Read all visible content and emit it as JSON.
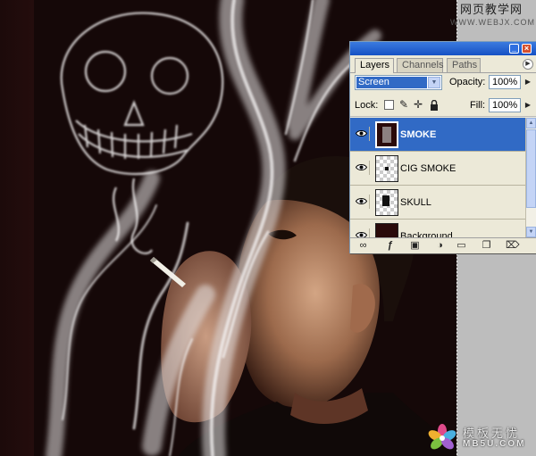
{
  "watermarks": {
    "top_text": "网页教学网",
    "top_url": "WWW.WEBJX.COM",
    "bottom_text": "模板无忧",
    "bottom_url": "MB5U.COM"
  },
  "panel": {
    "window_buttons": {
      "minimize": "_",
      "close": "×"
    },
    "tabs": [
      {
        "label": "Layers",
        "active": true
      },
      {
        "label": "Channels",
        "active": false
      },
      {
        "label": "Paths",
        "active": false
      }
    ],
    "blend_mode": "Screen",
    "opacity_label": "Opacity:",
    "opacity_value": "100%",
    "lock_label": "Lock:",
    "fill_label": "Fill:",
    "fill_value": "100%",
    "lock_icons": [
      "transparency-lock-icon",
      "brush-icon",
      "move-icon",
      "padlock-icon"
    ],
    "layers": [
      {
        "name": "SMOKE",
        "visible": true,
        "selected": true
      },
      {
        "name": "CIG SMOKE",
        "visible": true,
        "selected": false
      },
      {
        "name": "SKULL",
        "visible": true,
        "selected": false
      },
      {
        "name": "Background",
        "visible": true,
        "selected": false
      }
    ],
    "bottom_icons": [
      "link-icon",
      "fx-icon",
      "mask-icon",
      "adjustment-icon",
      "folder-icon",
      "new-layer-icon",
      "trash-icon"
    ]
  },
  "colors": {
    "selection": "#316ac5",
    "titlebar": "#1651c4",
    "panel_bg": "#ece9d8",
    "canvas_bg": "#150808"
  }
}
